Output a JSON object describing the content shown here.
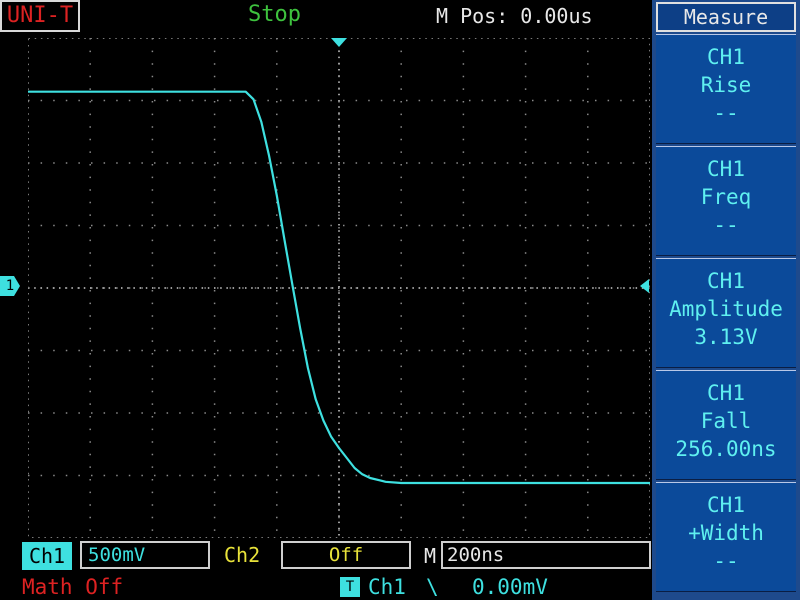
{
  "header": {
    "brand": "UNI-T",
    "run_state": "Stop",
    "main_position": "M Pos: 0.00us"
  },
  "markers": {
    "ch1_ground": "1",
    "trigger_box": "T"
  },
  "side_panel": {
    "title": "Measure",
    "items": [
      {
        "channel": "CH1",
        "name": "Rise",
        "value": "--"
      },
      {
        "channel": "CH1",
        "name": "Freq",
        "value": "--"
      },
      {
        "channel": "CH1",
        "name": "Amplitude",
        "value": "3.13V"
      },
      {
        "channel": "CH1",
        "name": "Fall",
        "value": "256.00ns"
      },
      {
        "channel": "CH1",
        "name": "+Width",
        "value": "--"
      }
    ]
  },
  "footer": {
    "ch1_label": "Ch1",
    "ch1_scale": "500mV",
    "ch2_label": "Ch2",
    "ch2_scale": "Off",
    "timebase_label": "M",
    "timebase": "200ns",
    "math": "Math Off",
    "trigger_source": "Ch1",
    "trigger_slope": "\\",
    "trigger_level": "0.00mV"
  },
  "colors": {
    "ch1": "#3ee0e0",
    "ch2": "#e8e23a",
    "panel": "#0b4a9a",
    "status": "#3ec23e",
    "brand": "#dd2222"
  },
  "chart_data": {
    "type": "line",
    "series": [
      {
        "name": "Ch1",
        "time_ns": [
          -1000,
          -300,
          -275,
          -250,
          -225,
          -200,
          -175,
          -150,
          -125,
          -100,
          -75,
          -50,
          -25,
          0,
          25,
          50,
          75,
          100,
          150,
          200,
          300,
          400,
          1000
        ],
        "volts": [
          1.57,
          1.57,
          1.51,
          1.33,
          1.06,
          0.74,
          0.38,
          0.03,
          -0.32,
          -0.64,
          -0.89,
          -1.06,
          -1.19,
          -1.28,
          -1.36,
          -1.44,
          -1.49,
          -1.52,
          -1.55,
          -1.56,
          -1.56,
          -1.56,
          -1.56
        ]
      }
    ],
    "x_divisions": 10,
    "y_divisions": 8,
    "volts_per_div": 0.5,
    "ns_per_div": 200,
    "xlim": [
      -1000,
      1000
    ],
    "ylim": [
      -2.0,
      2.0
    ],
    "grid": true
  }
}
